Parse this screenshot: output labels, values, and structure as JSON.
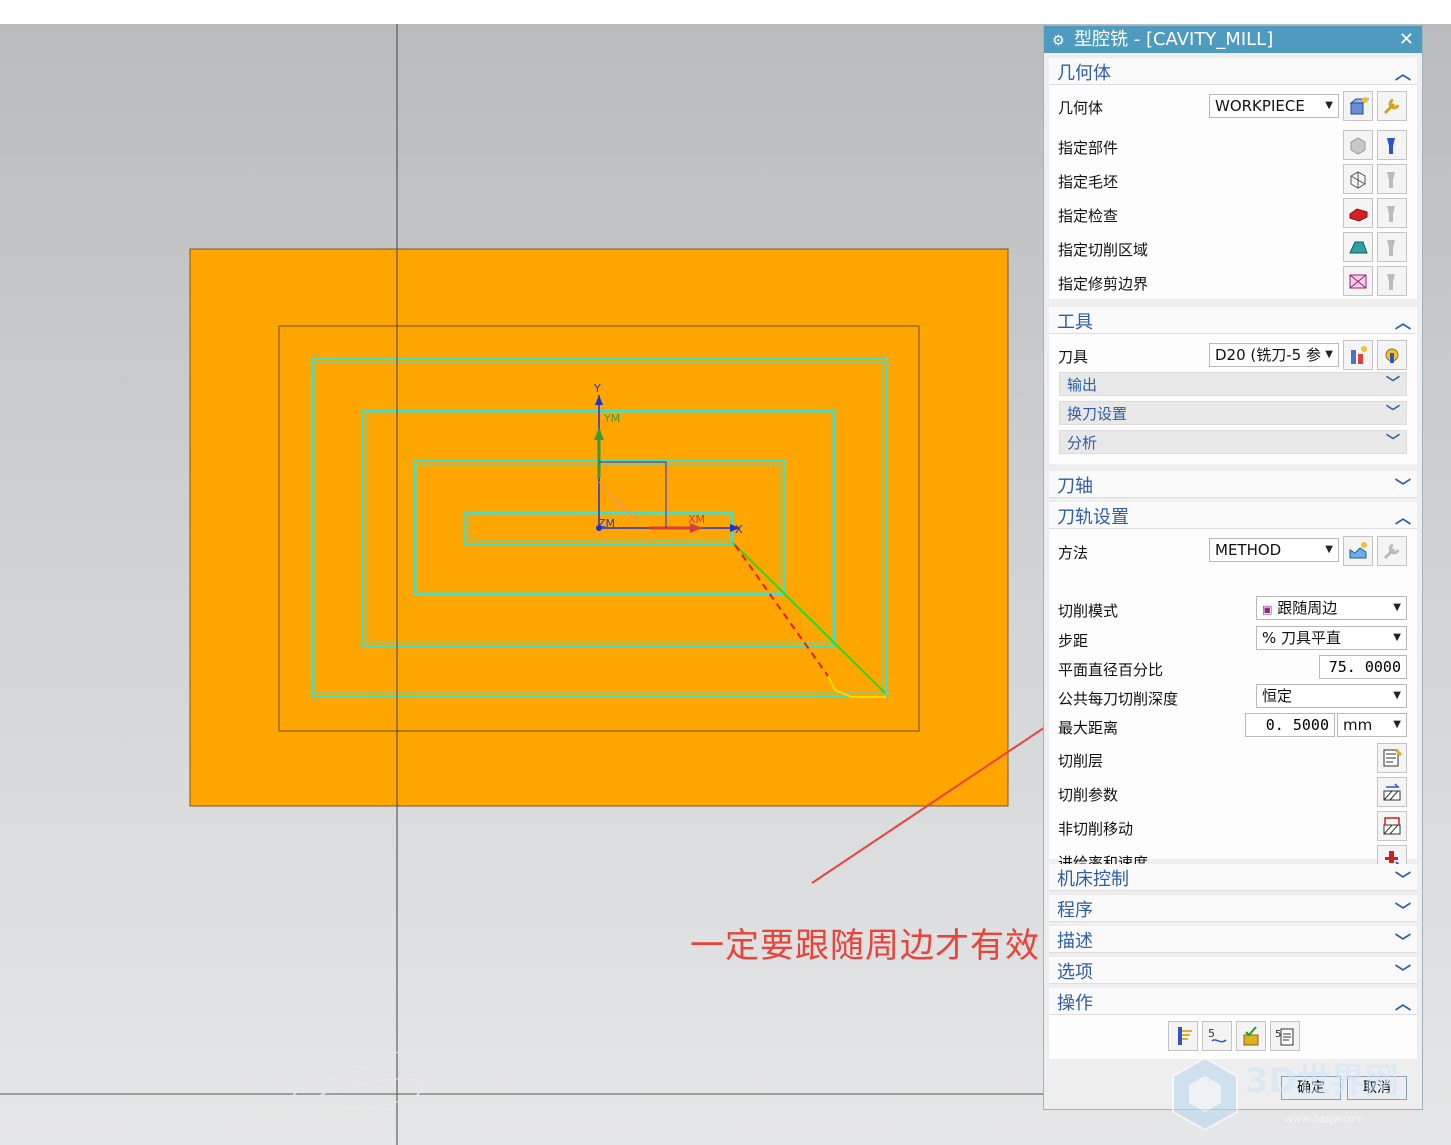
{
  "dialog": {
    "title": "型腔铣 - [CAVITY_MILL]",
    "close_icon": "close-icon",
    "sections": {
      "geometry": {
        "header": "几何体",
        "geometry_label": "几何体",
        "geometry_value": "WORKPIECE",
        "specify_part": "指定部件",
        "specify_blank": "指定毛坯",
        "specify_check": "指定检查",
        "specify_cut_area": "指定切削区域",
        "specify_trim_boundary": "指定修剪边界"
      },
      "tool": {
        "header": "工具",
        "tool_label": "刀具",
        "tool_value": "D20 (铣刀-5 参",
        "output": "输出",
        "tool_change": "换刀设置",
        "analysis": "分析"
      },
      "axis": {
        "header": "刀轴"
      },
      "path": {
        "header": "刀轨设置",
        "method_label": "方法",
        "method_value": "METHOD",
        "cut_pattern_label": "切削模式",
        "cut_pattern_value": "跟随周边",
        "stepover_label": "步距",
        "stepover_value": "% 刀具平直",
        "flat_pct_label": "平面直径百分比",
        "flat_pct_value": "75. 0000",
        "depth_label": "公共每刀切削深度",
        "depth_value": "恒定",
        "max_dist_label": "最大距离",
        "max_dist_value": "0. 5000",
        "max_dist_unit": "mm",
        "cut_levels": "切削层",
        "cut_params": "切削参数",
        "non_cut_moves": "非切削移动",
        "feeds_speeds": "进给率和速度"
      },
      "machine_control": {
        "header": "机床控制"
      },
      "program": {
        "header": "程序"
      },
      "description": {
        "header": "描述"
      },
      "options": {
        "header": "选项"
      },
      "actions": {
        "header": "操作"
      }
    },
    "ok": "确定",
    "cancel": "取消"
  },
  "viewport": {
    "axis_labels": {
      "y": "Y",
      "ym": "YM",
      "zm": "ZM",
      "xm": "XM",
      "x": "X"
    }
  },
  "annotation": "一定要跟随周边才有效",
  "watermark": "3D世界网",
  "watermark_url": "www.3dsjw.com",
  "colors": {
    "part": "#ffa500",
    "toolpath": "#40e0d0",
    "accent": "#4f9bbf",
    "annotation": "#e8443a"
  }
}
